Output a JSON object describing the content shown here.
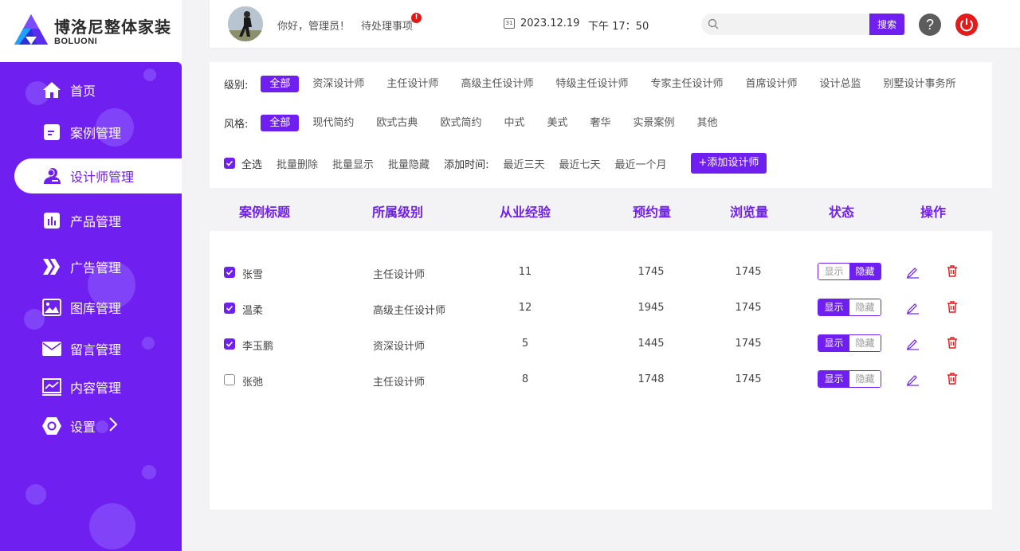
{
  "brand": {
    "name": "博洛尼整体家装",
    "sub": "BOLUONI"
  },
  "nav": [
    {
      "label": "首页",
      "icon": "home-icon"
    },
    {
      "label": "案例管理",
      "icon": "document-icon"
    },
    {
      "label": "设计师管理",
      "icon": "user-icon",
      "active": true
    },
    {
      "label": "产品管理",
      "icon": "chart-icon"
    },
    {
      "label": "广告管理",
      "icon": "chevrons-icon"
    },
    {
      "label": "图库管理",
      "icon": "image-icon"
    },
    {
      "label": "留言管理",
      "icon": "mail-icon"
    },
    {
      "label": "内容管理",
      "icon": "trend-icon"
    },
    {
      "label": "设置",
      "icon": "hexagon-icon"
    }
  ],
  "header": {
    "greeting": "你好，管理员！",
    "pending": "待处理事项",
    "pending_badge": "!",
    "date": "2023.12.19",
    "time": "下午 17：50",
    "search_placeholder": "",
    "search_button": "搜索",
    "help_label": "?"
  },
  "filters": {
    "level_label": "级别:",
    "levels": [
      "全部",
      "资深设计师",
      "主任设计师",
      "高级主任设计师",
      "特级主任设计师",
      "专家主任设计师",
      "首席设计师",
      "设计总监",
      "别墅设计事务所"
    ],
    "style_label": "风格:",
    "styles": [
      "全部",
      "现代简约",
      "欧式古典",
      "欧式简约",
      "中式",
      "美式",
      "奢华",
      "实景案例",
      "其他"
    ],
    "select_all": "全选",
    "batch_delete": "批量删除",
    "batch_show": "批量显示",
    "batch_hide": "批量隐藏",
    "add_time_label": "添加时间:",
    "time_3d": "最近三天",
    "time_7d": "最近七天",
    "time_1m": "最近一个月",
    "add_designer": "+添加设计师"
  },
  "table": {
    "headers": [
      "案例标题",
      "所属级别",
      "从业经验",
      "预约量",
      "浏览量",
      "状态",
      "操作"
    ],
    "show_label": "显示",
    "hide_label": "隐藏",
    "rows": [
      {
        "checked": true,
        "name": "张雪",
        "level": "主任设计师",
        "exp": "11",
        "bookings": "1745",
        "views": "1745",
        "state": "hide"
      },
      {
        "checked": true,
        "name": "温柔",
        "level": "高级主任设计师",
        "exp": "12",
        "bookings": "1945",
        "views": "1745",
        "state": "show"
      },
      {
        "checked": true,
        "name": "李玉鹏",
        "level": "资深设计师",
        "exp": "5",
        "bookings": "1445",
        "views": "1745",
        "state": "show"
      },
      {
        "checked": false,
        "name": "张弛",
        "level": "主任设计师",
        "exp": "8",
        "bookings": "1748",
        "views": "1745",
        "state": "show"
      }
    ]
  },
  "colors": {
    "accent": "#6f1ff0",
    "danger": "#e31b1b"
  }
}
